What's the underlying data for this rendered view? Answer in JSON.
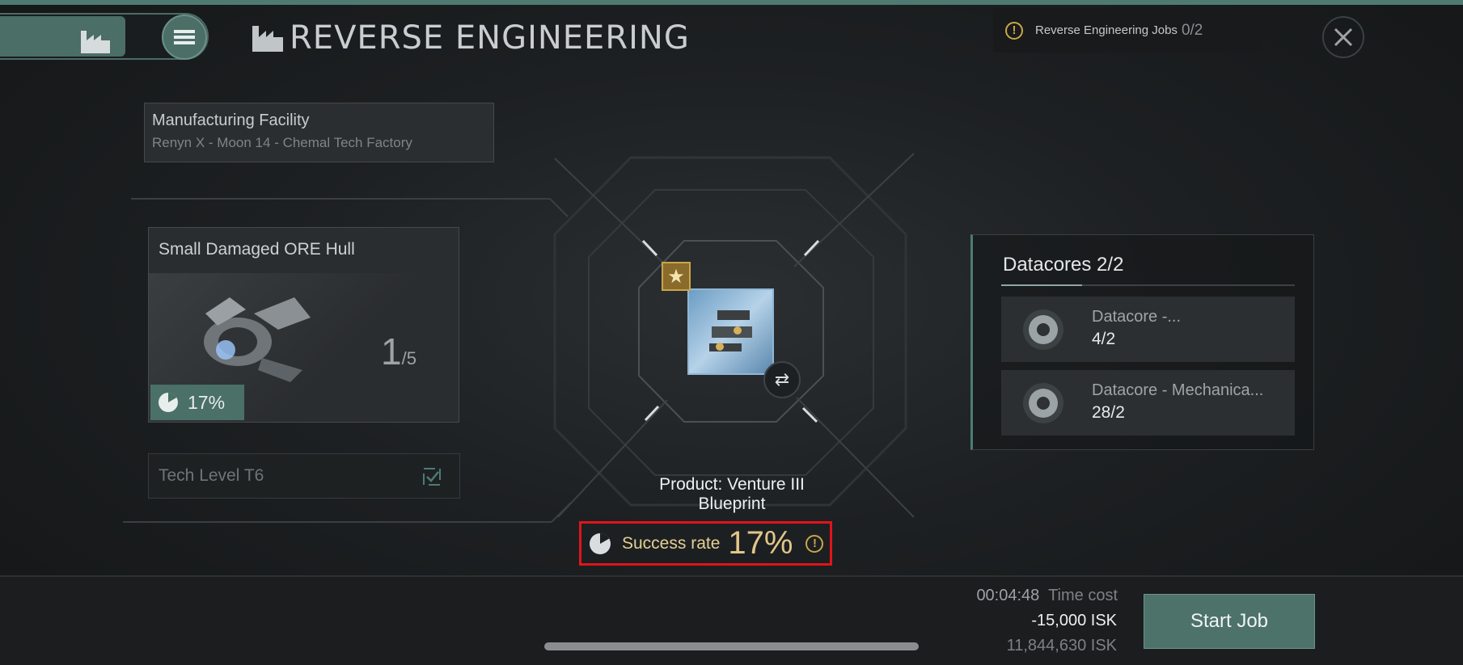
{
  "header": {
    "title": "REVERSE ENGINEERING",
    "jobs_label": "Reverse Engineering Jobs",
    "jobs_count": "0/2"
  },
  "facility": {
    "label": "Manufacturing Facility",
    "location": "Renyn X - Moon 14 - Chemal Tech Factory"
  },
  "item": {
    "name": "Small Damaged ORE Hull",
    "quantity": "1",
    "quantity_total": "/5",
    "rate": "17%"
  },
  "tech": {
    "label": "Tech Level T6"
  },
  "product": {
    "label": "Product: Venture III Blueprint"
  },
  "success": {
    "label": "Success rate",
    "value": "17%"
  },
  "datacores": {
    "title": "Datacores 2/2",
    "items": [
      {
        "name": "Datacore -...",
        "count": "4/2"
      },
      {
        "name": "Datacore - Mechanica...",
        "count": "28/2"
      }
    ]
  },
  "footer": {
    "time": "00:04:48",
    "time_label": "Time cost",
    "cost": "-15,000 ISK",
    "balance": "11,844,630 ISK",
    "start_label": "Start Job"
  },
  "colors": {
    "accent": "#4d7269",
    "gold": "#e2c689",
    "highlight": "#e0141a"
  }
}
